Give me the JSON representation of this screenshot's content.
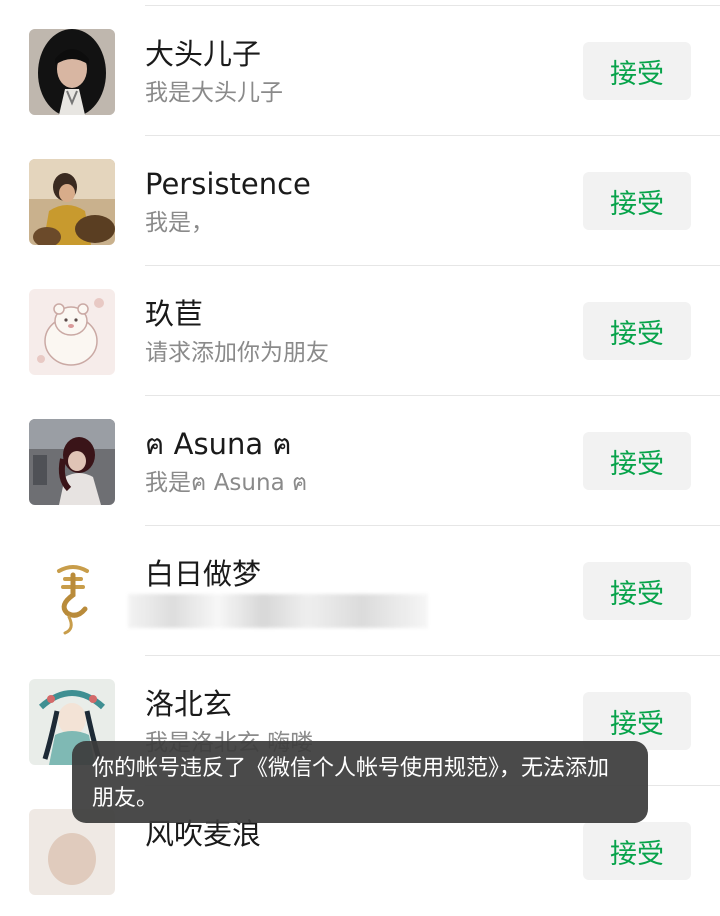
{
  "accept_label": "接受",
  "requests": [
    {
      "name": "大头儿子",
      "message": "我是大头儿子"
    },
    {
      "name": "Persistence",
      "message": "我是，"
    },
    {
      "name": "玖苣",
      "message": "请求添加你为朋友"
    },
    {
      "name": "ฅ Asuna ฅ",
      "message": "我是ฅ Asuna ฅ"
    },
    {
      "name": "白日做梦",
      "message": ""
    },
    {
      "name": "洛北玄",
      "message": "我是洛北玄 嗨喽"
    },
    {
      "name": "风吹麦浪",
      "message": ""
    }
  ],
  "toast": {
    "text": "你的帐号违反了《微信个人帐号使用规范》，无法添加朋友。"
  },
  "colors": {
    "accent": "#07a34a",
    "button_bg": "#f2f2f2",
    "toast_bg": "#3c3c3c"
  }
}
